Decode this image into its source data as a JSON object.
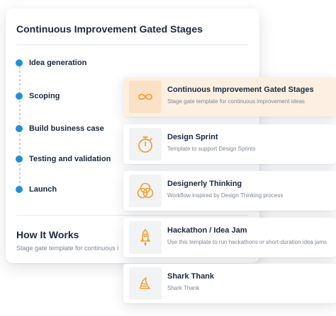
{
  "detail_card": {
    "title": "Continuous Improvement Gated Stages",
    "stages": [
      {
        "label": "Idea generation"
      },
      {
        "label": "Scoping"
      },
      {
        "label": "Build business case"
      },
      {
        "label": "Testing and validation"
      },
      {
        "label": "Launch"
      }
    ],
    "how_it_works": {
      "title": "How It Works",
      "description": "Stage gate template for continuous i"
    }
  },
  "templates": [
    {
      "title": "Continuous Improvement Gated Stages",
      "description": "Stage gate template for continuous improvement ideas",
      "icon": "infinity-icon",
      "selected": true
    },
    {
      "title": "Design Sprint",
      "description": "Template to support Design Sprints",
      "icon": "stopwatch-icon",
      "selected": false
    },
    {
      "title": "Designerly Thinking",
      "description": "Workflow inspired by Design Thinking process",
      "icon": "venn-circles-icon",
      "selected": false
    },
    {
      "title": "Hackathon / Idea Jam",
      "description": "Use this template to run hackathons or short-duration idea jams",
      "icon": "rocket-icon",
      "selected": false
    },
    {
      "title": "Shark Thank",
      "description": "Shark Thank",
      "icon": "shark-fin-icon",
      "selected": false
    }
  ],
  "colors": {
    "stage_dot": "#1f8fd8",
    "icon_accent": "#f0a030",
    "selected_background": "#fdf0e2"
  }
}
